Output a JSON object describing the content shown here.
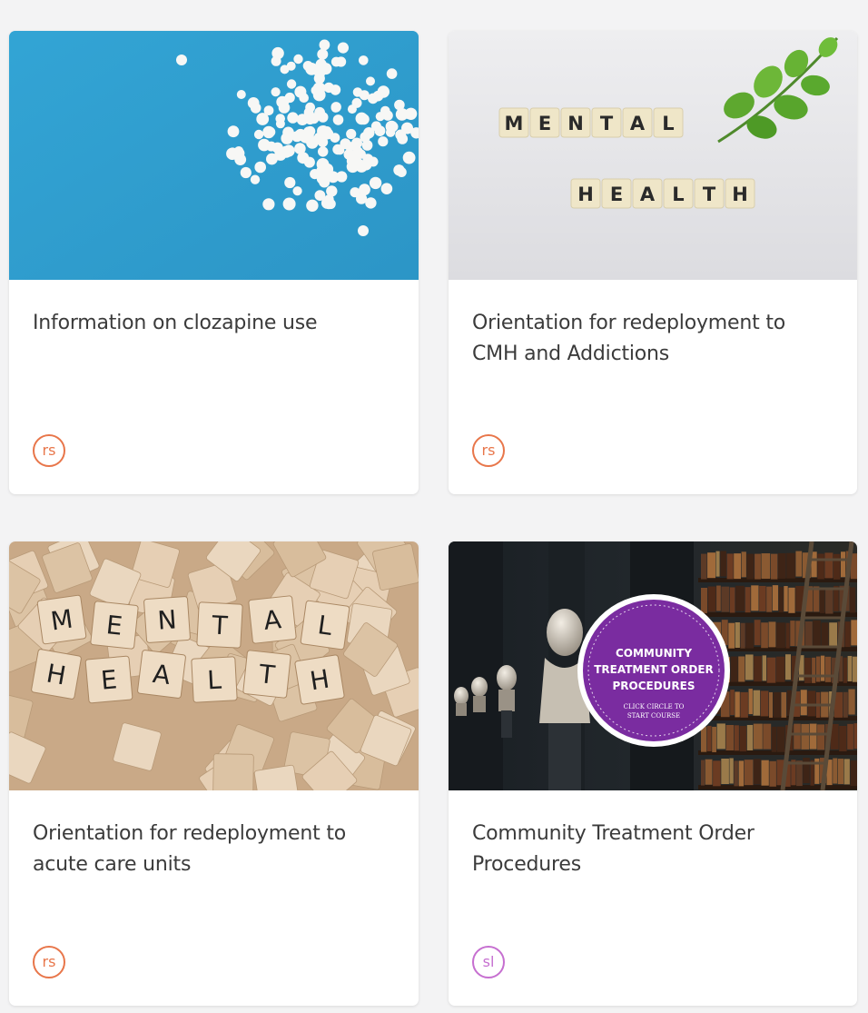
{
  "colors": {
    "background": "#f3f3f4",
    "card": "#ffffff",
    "title_text": "#3b3b3b",
    "avatar_orange": "#e8764a",
    "avatar_pink": "#c66fd0"
  },
  "courses": [
    {
      "title": "Information on clozapine use",
      "image": "white-pills-on-blue-background",
      "author_initials": "rs",
      "author_color": "#e8764a"
    },
    {
      "title": "Orientation for redeployment to CMH and Addictions",
      "image": "mental-health-letter-tiles-with-leaf",
      "image_text": [
        "MENTAL",
        "HEALTH"
      ],
      "author_initials": "rs",
      "author_color": "#e8764a"
    },
    {
      "title": "Orientation for redeployment to acute care units",
      "image": "scrabble-tiles-mental-health",
      "image_text": [
        "MENTAL",
        "HEALTH"
      ],
      "author_initials": "rs",
      "author_color": "#e8764a"
    },
    {
      "title": "Community Treatment Order Procedures",
      "image": "library-busts-with-purple-badge",
      "badge": {
        "line1": "COMMUNITY",
        "line2": "TREATMENT ORDER",
        "line3": "PROCEDURES",
        "sub1": "CLICK CIRCLE TO",
        "sub2": "START COURSE"
      },
      "author_initials": "sl",
      "author_color": "#c66fd0"
    }
  ]
}
